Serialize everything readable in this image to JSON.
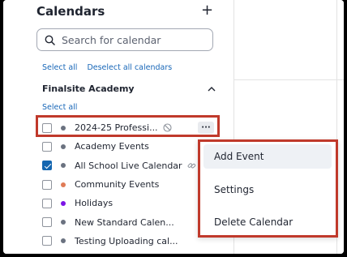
{
  "sidebar": {
    "title": "Calendars",
    "add_icon": "plus-icon",
    "search": {
      "placeholder": "Search for calendar",
      "icon": "search-icon"
    },
    "select_all": "Select all",
    "deselect_all": "Deselect all calendars",
    "group": {
      "title": "Finalsite Academy",
      "chevron_icon": "chevron-up-icon",
      "select_all": "Select all",
      "items": [
        {
          "label": "2024-25 Professi...",
          "color": "#6b7280",
          "checked": false,
          "icon": "hidden-icon",
          "more_label": "···"
        },
        {
          "label": "Academy Events",
          "color": "#6b7280",
          "checked": false
        },
        {
          "label": "All School Live Calendar",
          "color": "#6b7280",
          "checked": true,
          "icon": "link-icon"
        },
        {
          "label": "Community Events",
          "color": "#e07b56",
          "checked": false
        },
        {
          "label": "Holidays",
          "color": "#7c14e6",
          "checked": false
        },
        {
          "label": "New Standard Calen...",
          "color": "#6b7280",
          "checked": false
        },
        {
          "label": "Testing Uploading cal...",
          "color": "#6b7280",
          "checked": false
        }
      ]
    }
  },
  "context_menu": {
    "items": [
      {
        "label": "Add Event"
      },
      {
        "label": "Settings"
      },
      {
        "label": "Delete Calendar"
      }
    ]
  },
  "colors": {
    "highlight": "#c0392b",
    "link": "#1867b8",
    "checkbox_checked": "#1466b0"
  }
}
